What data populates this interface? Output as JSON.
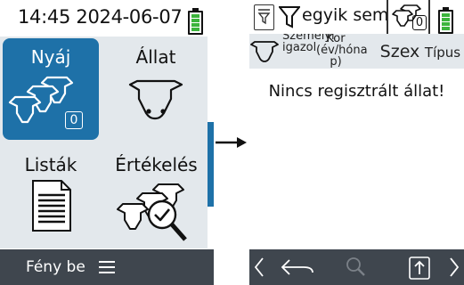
{
  "left_screen": {
    "status": {
      "time": "14:45 2024-06-07",
      "battery_level": 1.0,
      "battery_color": "#3cb43c"
    },
    "tiles": [
      {
        "label": "Nyáj",
        "badge": "0",
        "selected": true
      },
      {
        "label": "Állat"
      },
      {
        "label": "Listák"
      },
      {
        "label": "Értékelés"
      }
    ],
    "bottom": {
      "label": "Fény be",
      "menu_icon": "hamburger-icon"
    }
  },
  "right_screen": {
    "filter": {
      "text": "egyik sem"
    },
    "herd_badge": "0",
    "battery_level": 1.0,
    "columns": [
      "Személyi igazol",
      "Kor (év/hóna p)",
      "Szex",
      "Típus"
    ],
    "empty_message": "Nincs regisztrált állat!",
    "bottom_icons": [
      "chevron-left-icon",
      "back-icon",
      "search-icon",
      "upload-icon",
      "chevron-right-icon"
    ]
  },
  "colors": {
    "accent": "#1e71a8",
    "bar": "#3f464e",
    "panel": "#e3e8ec"
  }
}
